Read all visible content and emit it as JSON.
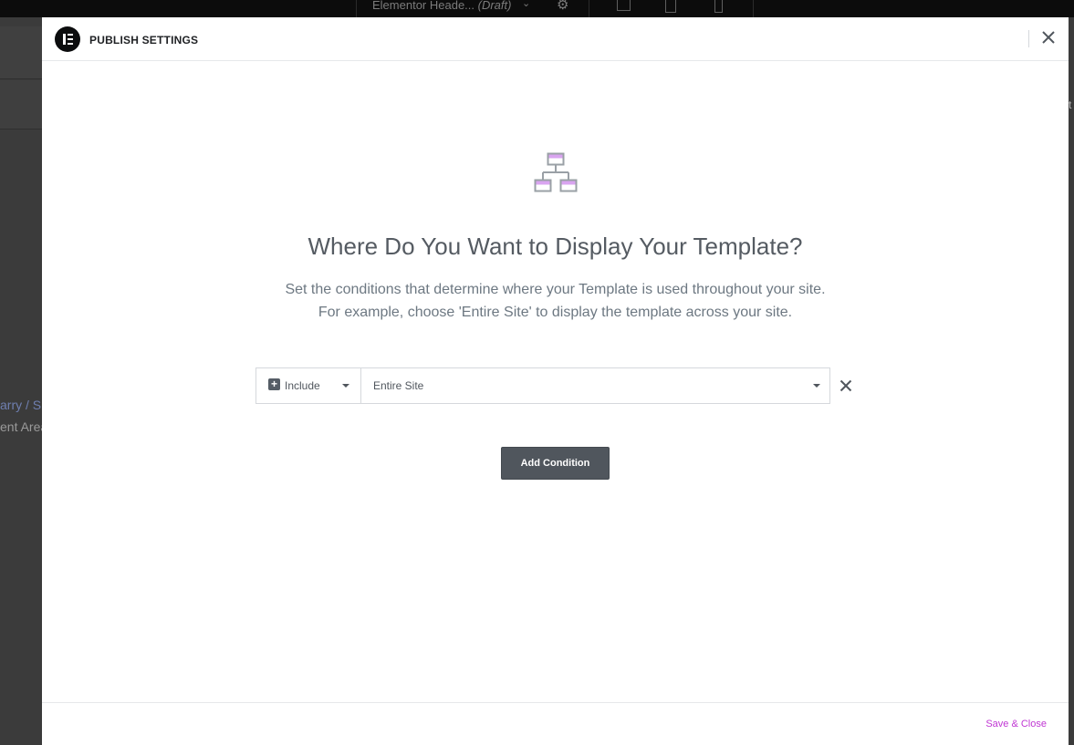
{
  "app": {
    "document_title": "Elementor Heade...",
    "document_status": "(Draft)"
  },
  "background": {
    "breadcrumb_fragment": "arry / S",
    "text_fragment": "ent Area",
    "right_fragment": "t"
  },
  "modal": {
    "title": "PUBLISH SETTINGS",
    "heading": "Where Do You Want to Display Your Template?",
    "description_line1": "Set the conditions that determine where your Template is used throughout your site.",
    "description_line2": "For example, choose 'Entire Site' to display the template across your site.",
    "conditions": [
      {
        "type": "Include",
        "target": "Entire Site"
      }
    ],
    "add_condition_label": "Add Condition",
    "save_close_label": "Save & Close"
  },
  "colors": {
    "accent": "#c036d3",
    "button_bg": "#50565d",
    "heading": "#555b62",
    "icon_highlight": "#d9a4f0"
  },
  "icons": {
    "logo": "elementor-logo-icon",
    "settings": "gear-icon",
    "close": "close-icon",
    "hero": "sitemap-icon",
    "include": "plus-square-icon",
    "dropdown": "caret-down-icon",
    "remove": "remove-condition-icon"
  }
}
